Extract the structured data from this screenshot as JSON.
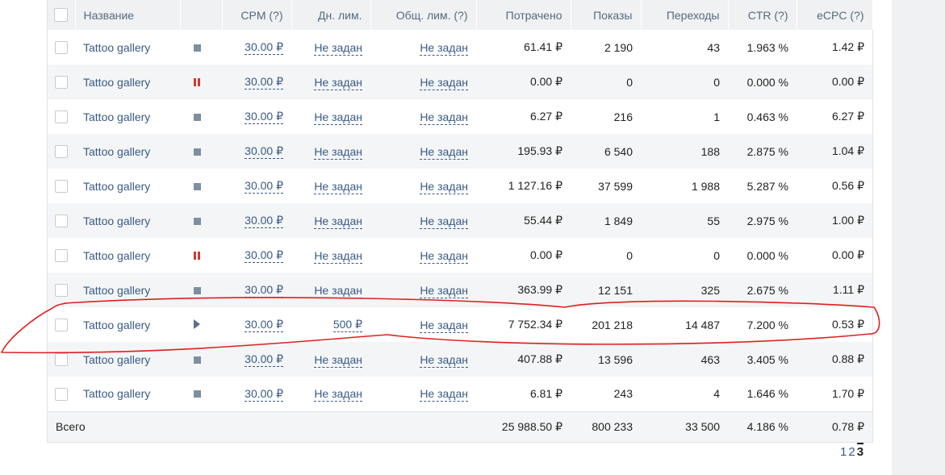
{
  "header": {
    "name": "Название",
    "cpm": "CPM (?)",
    "daily_limit": "Дн. лим.",
    "total_limit": "Общ. лим. (?)",
    "spent": "Потрачено",
    "impressions": "Показы",
    "clicks": "Переходы",
    "ctr": "CTR (?)",
    "ecpc": "eCPC (?)"
  },
  "status_icons": {
    "stopped": "stop-square-icon",
    "paused": "pause-icon",
    "running": "play-icon"
  },
  "colors": {
    "link": "#3a5a86",
    "paused": "#d03a2e",
    "annotation": "#e02020"
  },
  "rows": [
    {
      "name": "Tattoo gallery",
      "status": "stopped",
      "cpm": "30.00 ₽",
      "daily": "Не задан",
      "total": "Не задан",
      "spent": "61.41 ₽",
      "impressions": "2 190",
      "clicks": "43",
      "ctr": "1.963 %",
      "ecpc": "1.42 ₽"
    },
    {
      "name": "Tattoo gallery",
      "status": "paused",
      "cpm": "30.00 ₽",
      "daily": "Не задан",
      "total": "Не задан",
      "spent": "0.00 ₽",
      "impressions": "0",
      "clicks": "0",
      "ctr": "0.000 %",
      "ecpc": "0.00 ₽"
    },
    {
      "name": "Tattoo gallery",
      "status": "stopped",
      "cpm": "30.00 ₽",
      "daily": "Не задан",
      "total": "Не задан",
      "spent": "6.27 ₽",
      "impressions": "216",
      "clicks": "1",
      "ctr": "0.463 %",
      "ecpc": "6.27 ₽"
    },
    {
      "name": "Tattoo gallery",
      "status": "stopped",
      "cpm": "30.00 ₽",
      "daily": "Не задан",
      "total": "Не задан",
      "spent": "195.93 ₽",
      "impressions": "6 540",
      "clicks": "188",
      "ctr": "2.875 %",
      "ecpc": "1.04 ₽"
    },
    {
      "name": "Tattoo gallery",
      "status": "stopped",
      "cpm": "30.00 ₽",
      "daily": "Не задан",
      "total": "Не задан",
      "spent": "1 127.16 ₽",
      "impressions": "37 599",
      "clicks": "1 988",
      "ctr": "5.287 %",
      "ecpc": "0.56 ₽"
    },
    {
      "name": "Tattoo gallery",
      "status": "stopped",
      "cpm": "30.00 ₽",
      "daily": "Не задан",
      "total": "Не задан",
      "spent": "55.44 ₽",
      "impressions": "1 849",
      "clicks": "55",
      "ctr": "2.975 %",
      "ecpc": "1.00 ₽"
    },
    {
      "name": "Tattoo gallery",
      "status": "paused",
      "cpm": "30.00 ₽",
      "daily": "Не задан",
      "total": "Не задан",
      "spent": "0.00 ₽",
      "impressions": "0",
      "clicks": "0",
      "ctr": "0.000 %",
      "ecpc": "0.00 ₽"
    },
    {
      "name": "Tattoo gallery",
      "status": "stopped",
      "cpm": "30.00 ₽",
      "daily": "Не задан",
      "total": "Не задан",
      "spent": "363.99 ₽",
      "impressions": "12 151",
      "clicks": "325",
      "ctr": "2.675 %",
      "ecpc": "1.11 ₽"
    },
    {
      "name": "Tattoo gallery",
      "status": "running",
      "cpm": "30.00 ₽",
      "daily": "500 ₽",
      "total": "Не задан",
      "spent": "7 752.34 ₽",
      "impressions": "201 218",
      "clicks": "14 487",
      "ctr": "7.200 %",
      "ecpc": "0.53 ₽"
    },
    {
      "name": "Tattoo gallery",
      "status": "stopped",
      "cpm": "30.00 ₽",
      "daily": "Не задан",
      "total": "Не задан",
      "spent": "407.88 ₽",
      "impressions": "13 596",
      "clicks": "463",
      "ctr": "3.405 %",
      "ecpc": "0.88 ₽"
    },
    {
      "name": "Tattoo gallery",
      "status": "stopped",
      "cpm": "30.00 ₽",
      "daily": "Не задан",
      "total": "Не задан",
      "spent": "6.81 ₽",
      "impressions": "243",
      "clicks": "4",
      "ctr": "1.646 %",
      "ecpc": "1.70 ₽"
    }
  ],
  "totals": {
    "label": "Всего",
    "spent": "25 988.50 ₽",
    "impressions": "800 233",
    "clicks": "33 500",
    "ctr": "4.186 %",
    "ecpc": "0.78 ₽"
  },
  "pagination": {
    "pages": [
      "1",
      "2",
      "3"
    ],
    "current": "3"
  }
}
